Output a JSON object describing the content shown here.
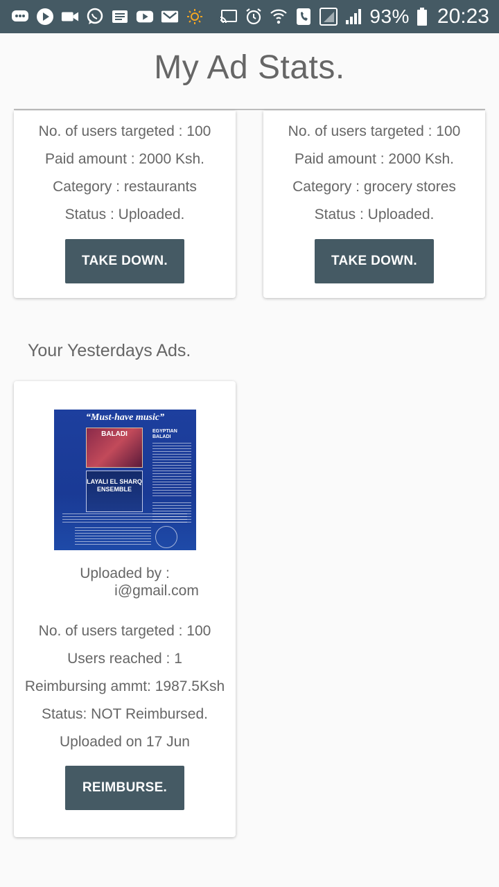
{
  "status_bar": {
    "battery": "93%",
    "time": "20:23",
    "left_icons": [
      "messages-icon",
      "play-icon",
      "video-icon",
      "whatsapp-icon",
      "news-icon",
      "youtube-icon",
      "gmail-icon",
      "brightness-icon"
    ],
    "right_icons": [
      "cast-icon",
      "alarm-icon",
      "wifi-call-icon",
      "call-icon",
      "signal-empty-icon",
      "signal-icon",
      "battery-icon"
    ]
  },
  "page": {
    "title": "My Ad Stats."
  },
  "current_ads": [
    {
      "users_targeted": "No. of users targeted : 100",
      "paid_amount": "Paid amount : 2000 Ksh.",
      "category": "Category : restaurants",
      "status": "Status : Uploaded.",
      "button_label": "TAKE DOWN."
    },
    {
      "users_targeted": "No. of users targeted : 100",
      "paid_amount": "Paid amount : 2000 Ksh.",
      "category": "Category : grocery stores",
      "status": "Status : Uploaded.",
      "button_label": "TAKE DOWN."
    }
  ],
  "yesterday": {
    "section_title": "Your Yesterdays Ads.",
    "ads": [
      {
        "poster": {
          "headline": "“Must-have music”",
          "box1": "BALADI",
          "box2": "LAYALI EL SHARQ ENSEMBLE",
          "side": "EGYPTIAN BALADI"
        },
        "uploaded_by_label": "Uploaded by :",
        "email_suffix": "i@gmail.com",
        "users_targeted": "No. of users targeted : 100",
        "users_reached": "Users reached : 1",
        "reimbursing": "Reimbursing ammt: 1987.5Ksh",
        "status": "Status: NOT Reimbursed.",
        "uploaded_on": "Uploaded on 17 Jun",
        "button_label": "REIMBURSE."
      }
    ]
  },
  "colors": {
    "status_bar": "#455a64",
    "button": "#455a64",
    "text": "#666666",
    "background": "#fafafa"
  }
}
